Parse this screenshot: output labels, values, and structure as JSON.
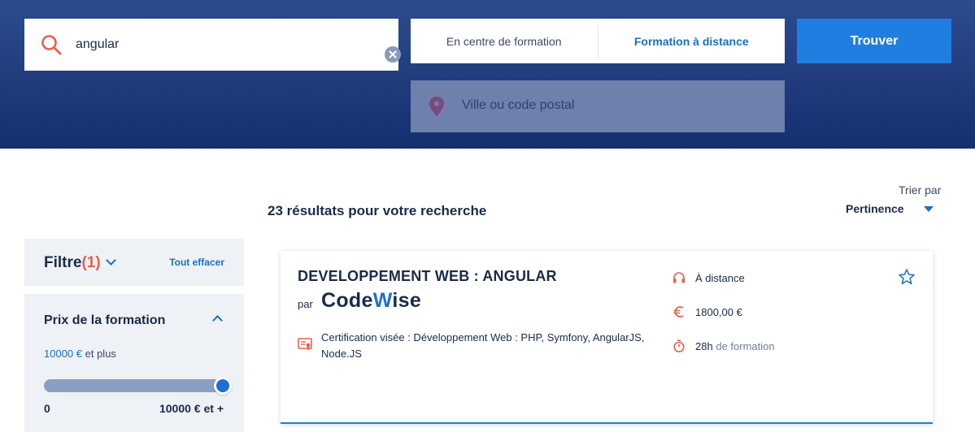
{
  "colors": {
    "header_top": "#2b4c8f",
    "header_bottom": "#132f6e",
    "accent_blue": "#1f7ee0",
    "icon_red": "#e8604c",
    "text_dark": "#1b2a4a",
    "location_bg": "#6f80ad",
    "filter_bg": "#eef1f6"
  },
  "search": {
    "query": "angular",
    "search_icon": "search-icon",
    "clear_icon": "close-circle-icon"
  },
  "mode": {
    "tabs": [
      {
        "label": "En centre de formation",
        "active": false
      },
      {
        "label": "Formation à distance",
        "active": true
      }
    ]
  },
  "find_button": {
    "label": "Trouver"
  },
  "location": {
    "placeholder": "Ville ou code postal",
    "icon": "map-pin-icon"
  },
  "results": {
    "count_text": "23 résultats pour votre recherche"
  },
  "sort": {
    "label": "Trier par",
    "value": "Pertinence"
  },
  "filters": {
    "title": "Filtre",
    "count": "(1)",
    "clear_all": "Tout effacer",
    "price": {
      "title": "Prix de la formation",
      "value_amount": "10000 €",
      "value_suffix": "et plus",
      "slider_fraction": 1.0,
      "min_label": "0",
      "max_label": "10000 € et +"
    }
  },
  "course": {
    "title": "DEVELOPPEMENT WEB : ANGULAR",
    "by": "par",
    "org_part1": "Code",
    "org_part2": "W",
    "org_part3": "ise",
    "certification": "Certification visée : Développement Web : PHP, Symfony, AngularJS, Node.JS",
    "mode": "À distance",
    "price": "1800,00 €",
    "duration_value": "28h",
    "duration_suffix": "de formation",
    "icons": [
      "headphones-icon",
      "euro-icon",
      "stopwatch-icon",
      "certificate-icon",
      "star-icon"
    ]
  }
}
